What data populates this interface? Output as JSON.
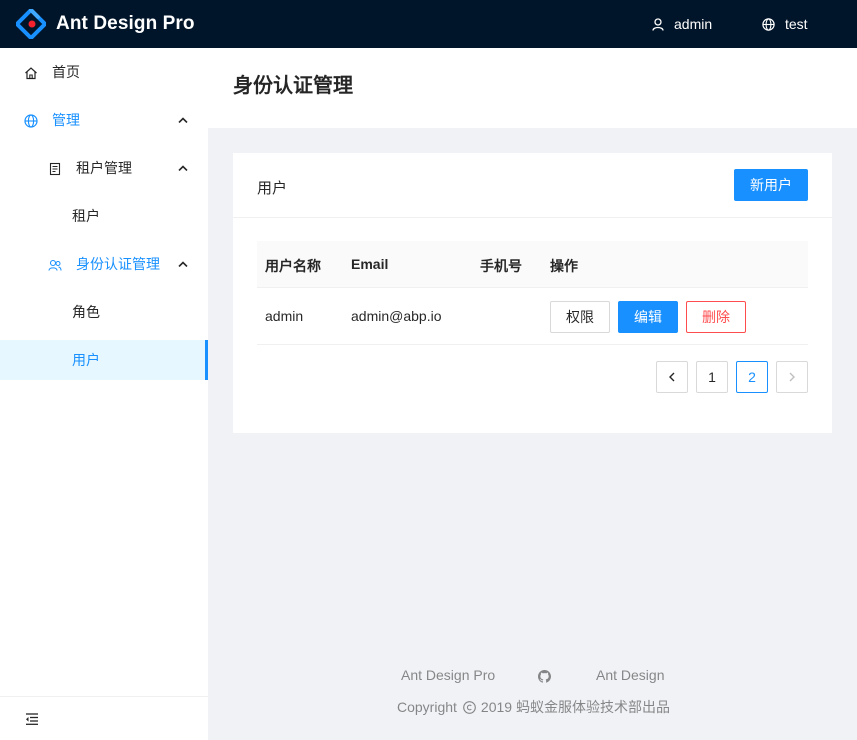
{
  "app": {
    "brand": "Ant Design Pro"
  },
  "header": {
    "user": {
      "name": "admin",
      "icon": "user-icon"
    },
    "locale": {
      "label": "test",
      "icon": "globe-icon"
    }
  },
  "sidebar": {
    "items": [
      {
        "label": "首页",
        "icon": "home-icon"
      },
      {
        "label": "管理",
        "icon": "globe-icon",
        "expanded": true
      },
      {
        "label": "租户管理",
        "icon": "book-icon",
        "expanded": true
      },
      {
        "label": "租户"
      },
      {
        "label": "身份认证管理",
        "icon": "team-icon",
        "expanded": true
      },
      {
        "label": "角色"
      },
      {
        "label": "用户",
        "selected": true
      }
    ],
    "collapse_icon": "menu-fold-icon"
  },
  "page": {
    "title": "身份认证管理"
  },
  "card": {
    "title": "用户",
    "new_button": "新用户"
  },
  "table": {
    "columns": [
      "用户名称",
      "Email",
      "手机号",
      "操作"
    ],
    "rows": [
      {
        "username": "admin",
        "email": "admin@abp.io",
        "phone": "",
        "actions": [
          "权限",
          "编辑",
          "删除"
        ]
      }
    ]
  },
  "pagination": {
    "pages": [
      "1",
      "2"
    ],
    "current": "2"
  },
  "footer": {
    "links": [
      "Ant Design Pro",
      "Ant Design"
    ],
    "github_icon": "github-icon",
    "copyright": "Copyright",
    "copyright_text": "2019 蚂蚁金服体验技术部出品"
  },
  "colors": {
    "primary": "#1890ff",
    "header_bg": "#001529",
    "danger": "#ff4d4f"
  }
}
